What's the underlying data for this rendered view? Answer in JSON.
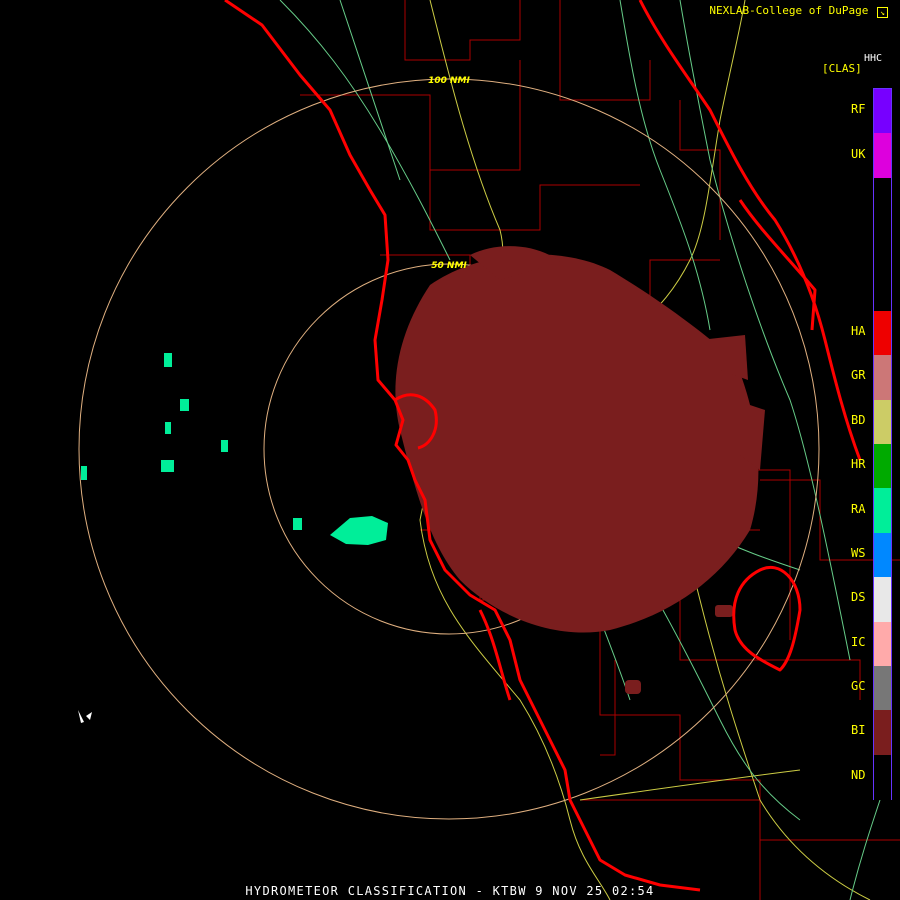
{
  "header": {
    "credit": "NEXLAB-College of DuPage",
    "product_code": "HHC",
    "product_bracket": "[CLAS]"
  },
  "footer": {
    "title": "HYDROMETEOR CLASSIFICATION - KTBW 9 NOV 25 02:54"
  },
  "range_rings": [
    {
      "label": "50 NMI"
    },
    {
      "label": "100 NMI"
    }
  ],
  "legend": [
    {
      "code": "RF",
      "color": "#7700ff"
    },
    {
      "code": "UK",
      "color": "#dd00dd"
    },
    {
      "code": "",
      "color": "#000000"
    },
    {
      "code": "",
      "color": "#000000"
    },
    {
      "code": "",
      "color": "#000000"
    },
    {
      "code": "HA",
      "color": "#ee0000"
    },
    {
      "code": "GR",
      "color": "#cc7777"
    },
    {
      "code": "BD",
      "color": "#cccc66"
    },
    {
      "code": "HR",
      "color": "#00aa00"
    },
    {
      "code": "RA",
      "color": "#00ee99"
    },
    {
      "code": "WS",
      "color": "#0088ff"
    },
    {
      "code": "DS",
      "color": "#e8e8e8"
    },
    {
      "code": "IC",
      "color": "#ffaaaa"
    },
    {
      "code": "GC",
      "color": "#777777"
    },
    {
      "code": "BI",
      "color": "#7a1e1e"
    },
    {
      "code": "ND",
      "color": "#000000"
    }
  ],
  "colors": {
    "coastline": "#ff0000",
    "county_lines": "#aa0000",
    "highways": "#cccc44",
    "roads": "#66cc88",
    "range_ring": "#e0b080",
    "biological_echo": "#7a1e1e",
    "rain_echo": "#00ee99"
  },
  "icons": {
    "close_marker": "box-arrow-icon",
    "cursor": "cursor-icon"
  }
}
